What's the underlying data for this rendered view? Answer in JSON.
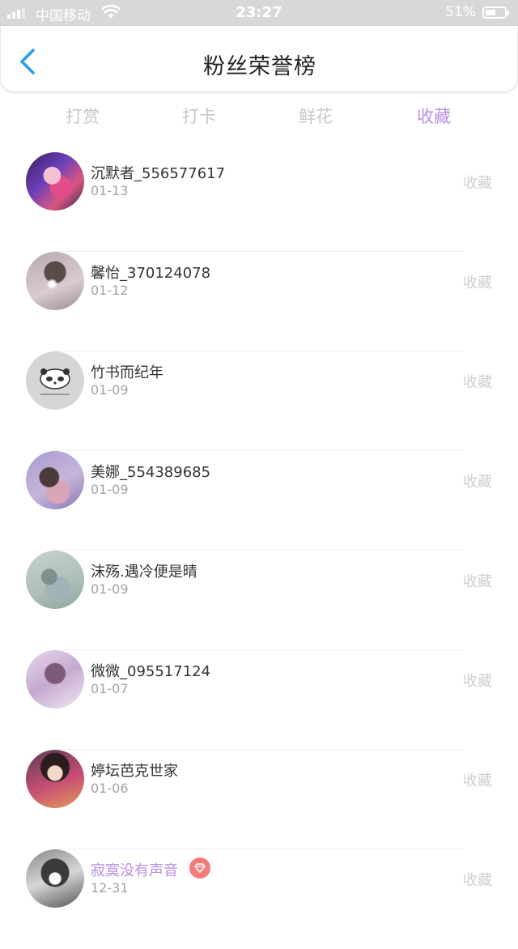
{
  "status_bar": {
    "carrier": "中国移动",
    "time": "23:27",
    "battery": "51%"
  },
  "header": {
    "title": "粉丝荣誉榜"
  },
  "tabs": [
    {
      "label": "打赏",
      "active": false
    },
    {
      "label": "打卡",
      "active": false
    },
    {
      "label": "鲜花",
      "active": false
    },
    {
      "label": "收藏",
      "active": true
    }
  ],
  "fans": [
    {
      "name": "沉默者_556577617",
      "date": "01-13",
      "type": "收藏"
    },
    {
      "name": "馨怡_370124078",
      "date": "01-12",
      "type": "收藏"
    },
    {
      "name": "竹书而纪年",
      "date": "01-09",
      "type": "收藏"
    },
    {
      "name": "美娜_554389685",
      "date": "01-09",
      "type": "收藏"
    },
    {
      "name": "沫殇.遇冷便是晴",
      "date": "01-09",
      "type": "收藏"
    },
    {
      "name": "微微_095517124",
      "date": "01-07",
      "type": "收藏"
    },
    {
      "name": "婷坛芭克世家",
      "date": "01-06",
      "type": "收藏"
    },
    {
      "name": "寂寞没有声音",
      "date": "12-31",
      "type": "收藏",
      "vip": true
    }
  ],
  "colors": {
    "accent": "#b98fe0",
    "back_icon": "#2a9ee8",
    "badge": "#f57b7b"
  }
}
